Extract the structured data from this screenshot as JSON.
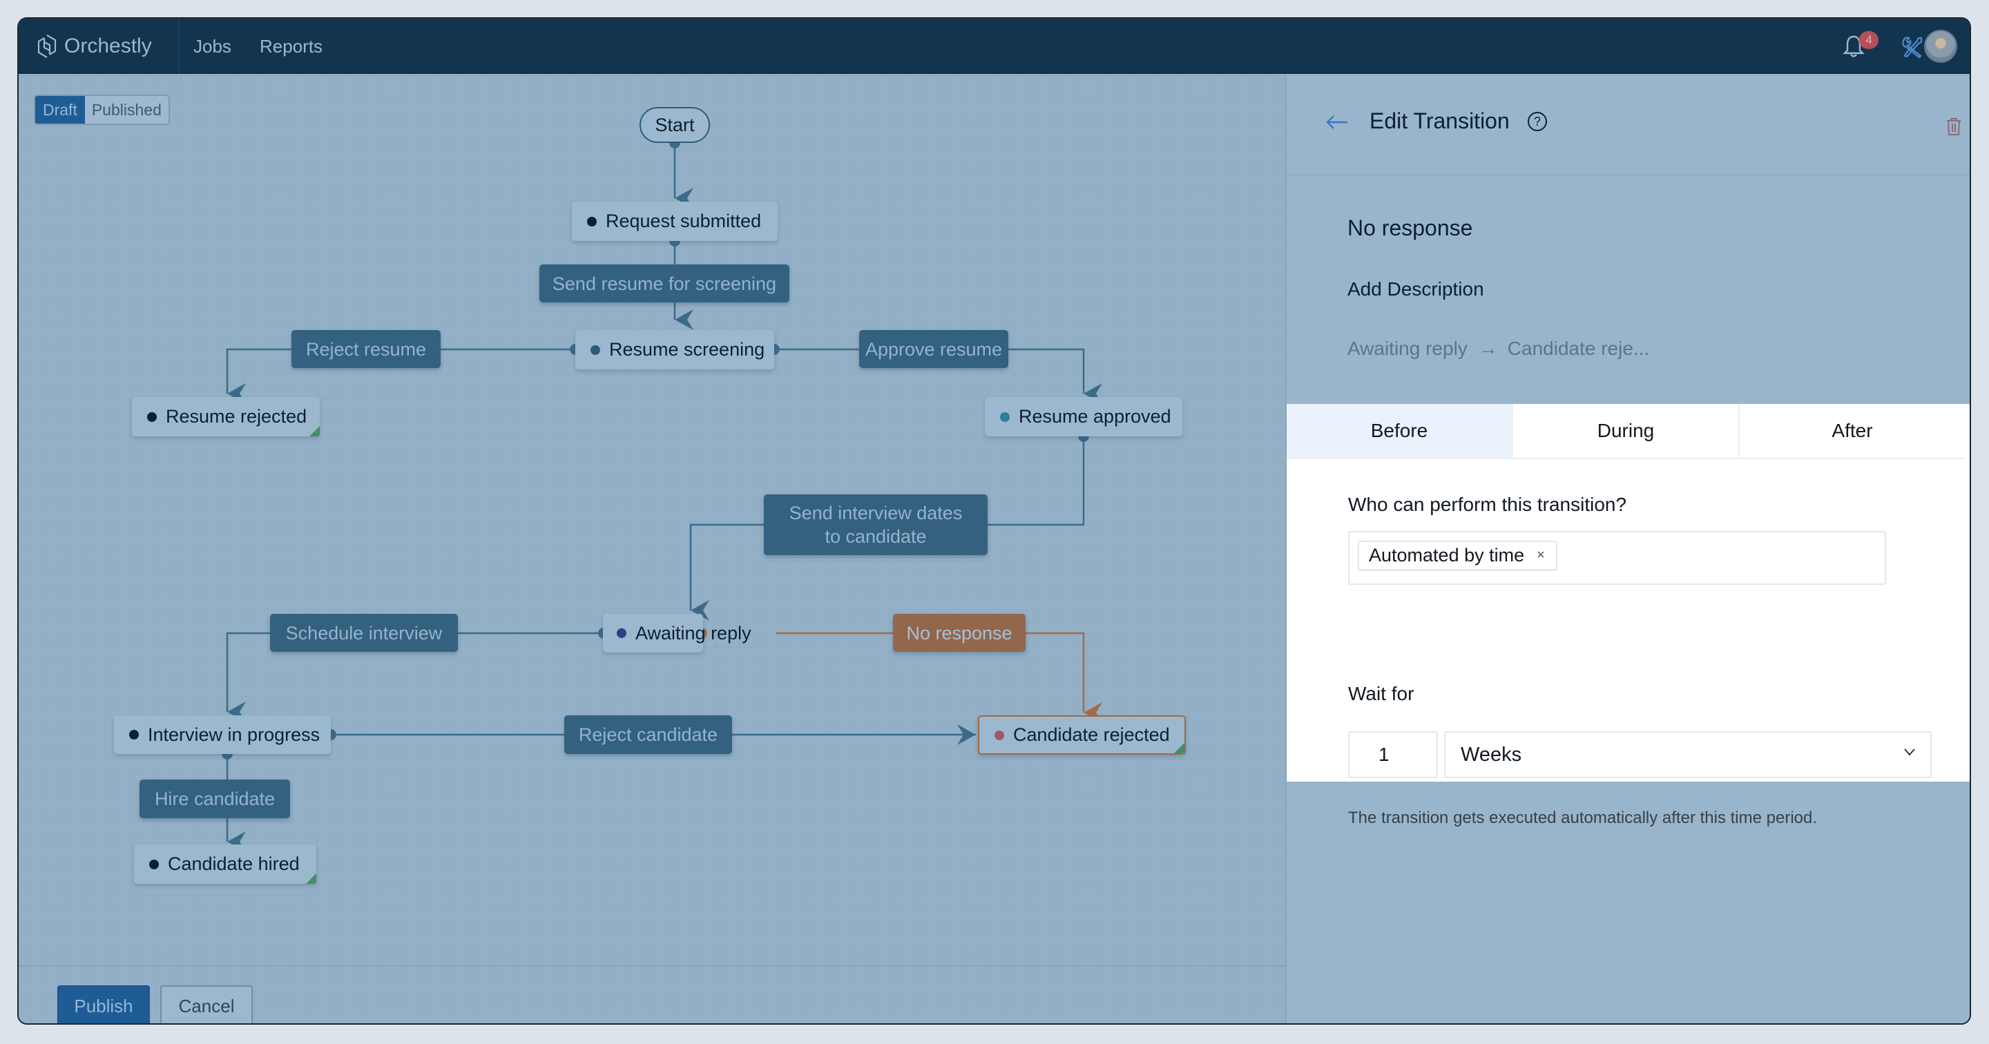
{
  "app": {
    "name": "Orchestly",
    "nav": [
      {
        "label": "Jobs"
      },
      {
        "label": "Reports"
      }
    ],
    "notifications_count": "4",
    "icons": {
      "logo": "orchestly-logo-icon",
      "bell": "bell-icon",
      "tools": "tools-icon",
      "avatar": "user-avatar"
    }
  },
  "canvas": {
    "mode_toggle": {
      "options": [
        "Draft",
        "Published"
      ],
      "selected": "Draft"
    },
    "start_label": "Start",
    "states": [
      {
        "id": "request_submitted",
        "label": "Request submitted",
        "dot_color": "#0c1f33",
        "end": false
      },
      {
        "id": "resume_screening",
        "label": "Resume screening",
        "dot_color": "#2d5a78",
        "end": false
      },
      {
        "id": "resume_rejected",
        "label": "Resume rejected",
        "dot_color": "#0c1f33",
        "end": true
      },
      {
        "id": "resume_approved",
        "label": "Resume approved",
        "dot_color": "#2f7d9c",
        "end": false
      },
      {
        "id": "awaiting_reply",
        "label": "Awaiting reply",
        "dot_color": "#2d3f87",
        "end": false
      },
      {
        "id": "interview_in_progress",
        "label": "Interview in progress",
        "dot_color": "#0c1f33",
        "end": false
      },
      {
        "id": "candidate_rejected",
        "label": "Candidate rejected",
        "dot_color": "#9a5b6b",
        "end": true,
        "selected": true
      },
      {
        "id": "candidate_hired",
        "label": "Candidate hired",
        "dot_color": "#0c1f33",
        "end": true
      }
    ],
    "transitions": [
      {
        "id": "send_resume",
        "label": "Send resume for screening",
        "from": "request_submitted",
        "to": "resume_screening"
      },
      {
        "id": "reject_resume",
        "label": "Reject resume",
        "from": "resume_screening",
        "to": "resume_rejected"
      },
      {
        "id": "approve_resume",
        "label": "Approve resume",
        "from": "resume_screening",
        "to": "resume_approved"
      },
      {
        "id": "send_dates",
        "label": "Send interview dates to candidate",
        "from": "resume_approved",
        "to": "awaiting_reply"
      },
      {
        "id": "schedule_interview",
        "label": "Schedule interview",
        "from": "awaiting_reply",
        "to": "interview_in_progress"
      },
      {
        "id": "no_response",
        "label": "No response",
        "from": "awaiting_reply",
        "to": "candidate_rejected",
        "active": true
      },
      {
        "id": "reject_candidate",
        "label": "Reject candidate",
        "from": "interview_in_progress",
        "to": "candidate_rejected"
      },
      {
        "id": "hire_candidate",
        "label": "Hire candidate",
        "from": "interview_in_progress",
        "to": "candidate_hired"
      }
    ],
    "edge_color": "#3c6a8a",
    "active_edge_color": "#a36b48",
    "end_marker_color": "#3f9065",
    "footer": {
      "publish_label": "Publish",
      "cancel_label": "Cancel"
    }
  },
  "panel": {
    "title": "Edit Transition",
    "help_glyph": "?",
    "transition_name": "No response",
    "add_description_label": "Add Description",
    "path": {
      "from": "Awaiting reply",
      "arrow": "→",
      "to": "Candidate reje..."
    },
    "tabs": [
      {
        "label": "Before",
        "active": true
      },
      {
        "label": "During",
        "active": false
      },
      {
        "label": "After",
        "active": false
      }
    ],
    "who_label": "Who can perform this transition?",
    "who_chips": [
      {
        "label": "Automated by time",
        "remove": "×"
      }
    ],
    "wait_label": "Wait for",
    "wait_value": "1",
    "wait_unit": "Weeks",
    "hint": "The transition gets executed automatically after this time period."
  }
}
